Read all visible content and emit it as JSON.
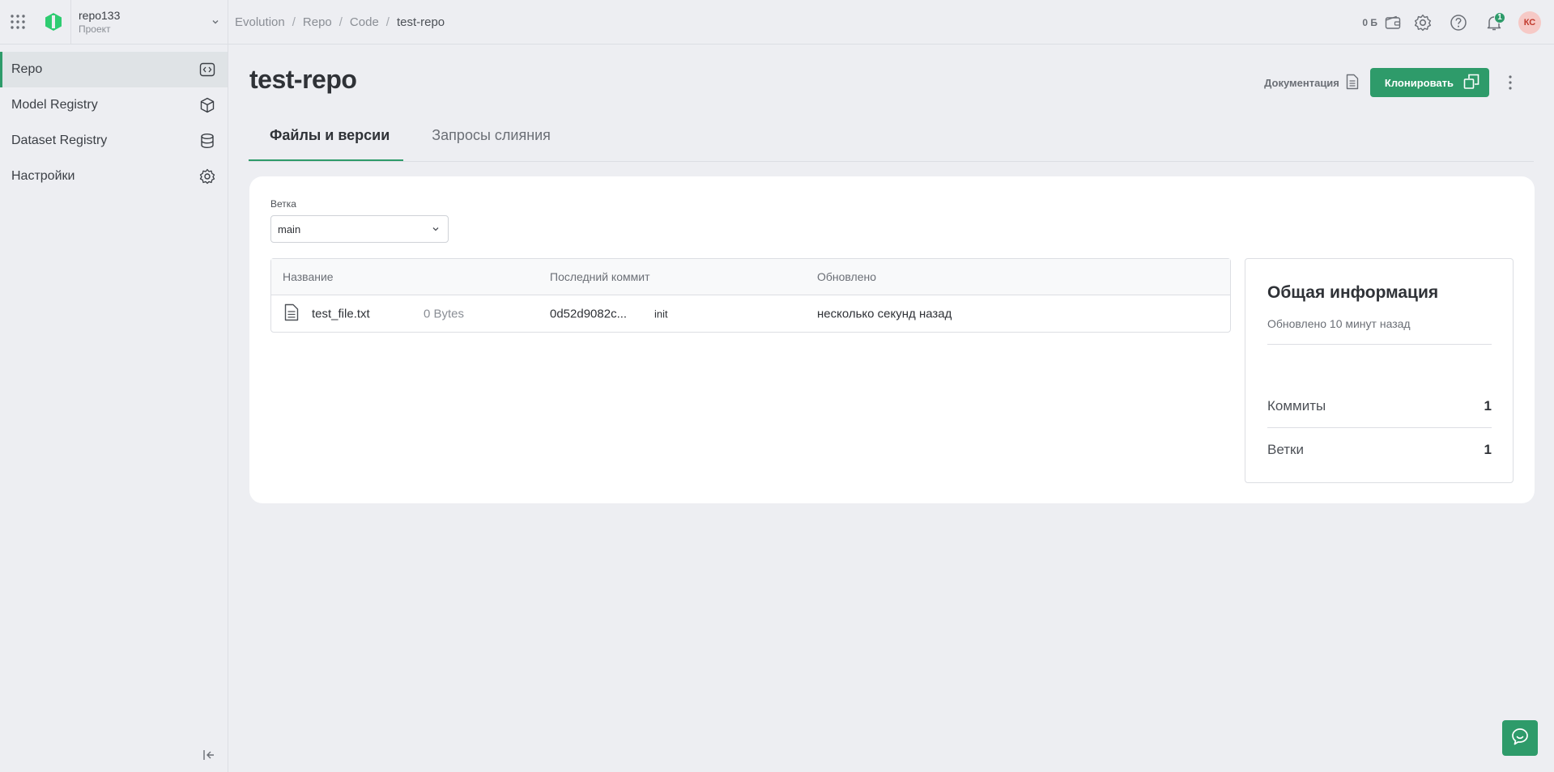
{
  "project": {
    "name": "repo133",
    "type": "Проект"
  },
  "sidebar": {
    "items": [
      {
        "label": "Repo",
        "icon": "code-brackets-icon"
      },
      {
        "label": "Model Registry",
        "icon": "cube-icon"
      },
      {
        "label": "Dataset Registry",
        "icon": "database-icon"
      },
      {
        "label": "Настройки",
        "icon": "gear-icon"
      }
    ]
  },
  "breadcrumb": {
    "items": [
      "Evolution",
      "Repo",
      "Code"
    ],
    "current": "test-repo"
  },
  "topbar": {
    "balance": "0 Б",
    "notification_count": "1",
    "avatar_initials": "КС"
  },
  "page": {
    "title": "test-repo",
    "docs_label": "Документация",
    "clone_label": "Клонировать"
  },
  "tabs": [
    {
      "label": "Файлы и версии",
      "active": true
    },
    {
      "label": "Запросы слияния",
      "active": false
    }
  ],
  "branch": {
    "label": "Ветка",
    "value": "main"
  },
  "files": {
    "columns": [
      "Название",
      "Последний коммит",
      "Обновлено"
    ],
    "rows": [
      {
        "name": "test_file.txt",
        "size": "0 Bytes",
        "commit_hash": "0d52d9082c...",
        "commit_msg": "init",
        "updated": "несколько секунд назад"
      }
    ]
  },
  "info": {
    "title": "Общая информация",
    "updated": "Обновлено 10 минут назад",
    "stats": [
      {
        "label": "Коммиты",
        "value": "1"
      },
      {
        "label": "Ветки",
        "value": "1"
      }
    ]
  },
  "colors": {
    "accent": "#2e9b6a",
    "background": "#edeef2",
    "card": "#ffffff"
  }
}
